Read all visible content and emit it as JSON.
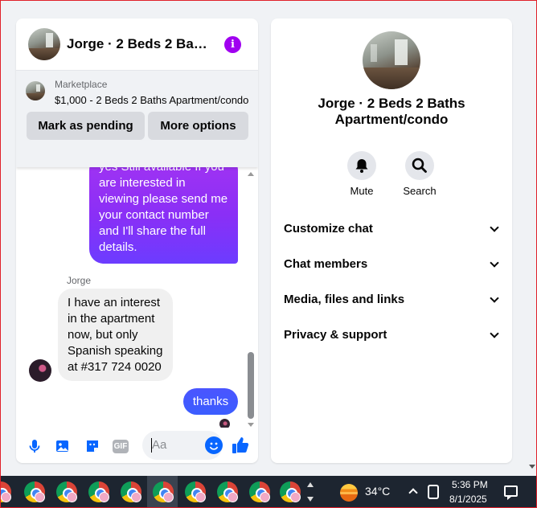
{
  "chat": {
    "title": "Jorge · 2 Beds 2 Bath…",
    "listing": {
      "source": "Marketplace",
      "title": "$1,000 - 2 Beds 2 Baths Apartment/condo",
      "pending_label": "Mark as pending",
      "more_label": "More options"
    },
    "messages": {
      "outgoing_1": "yes Still available If you are interested in viewing please send me your contact number and I'll share the full details.",
      "sender": "Jorge",
      "incoming_1": "I have an interest in the apartment now, but only Spanish speaking at #317 724 0020",
      "outgoing_2": "thanks"
    },
    "composer": {
      "placeholder": "Aa",
      "gif_label": "GIF"
    },
    "colors": {
      "accent": "#0866ff",
      "outgoing_purple": "#8a2ff6",
      "info": "#a000f0"
    }
  },
  "details": {
    "title": "Jorge · 2 Beds 2 Baths Apartment/condo",
    "actions": [
      {
        "label": "Mute",
        "icon": "bell-icon"
      },
      {
        "label": "Search",
        "icon": "search-icon"
      }
    ],
    "sections": [
      {
        "label": "Customize chat"
      },
      {
        "label": "Chat members"
      },
      {
        "label": "Media, files and links"
      },
      {
        "label": "Privacy & support"
      }
    ]
  },
  "taskbar": {
    "temperature": "34°C",
    "time": "5:36 PM",
    "date": "8/1/2025"
  }
}
